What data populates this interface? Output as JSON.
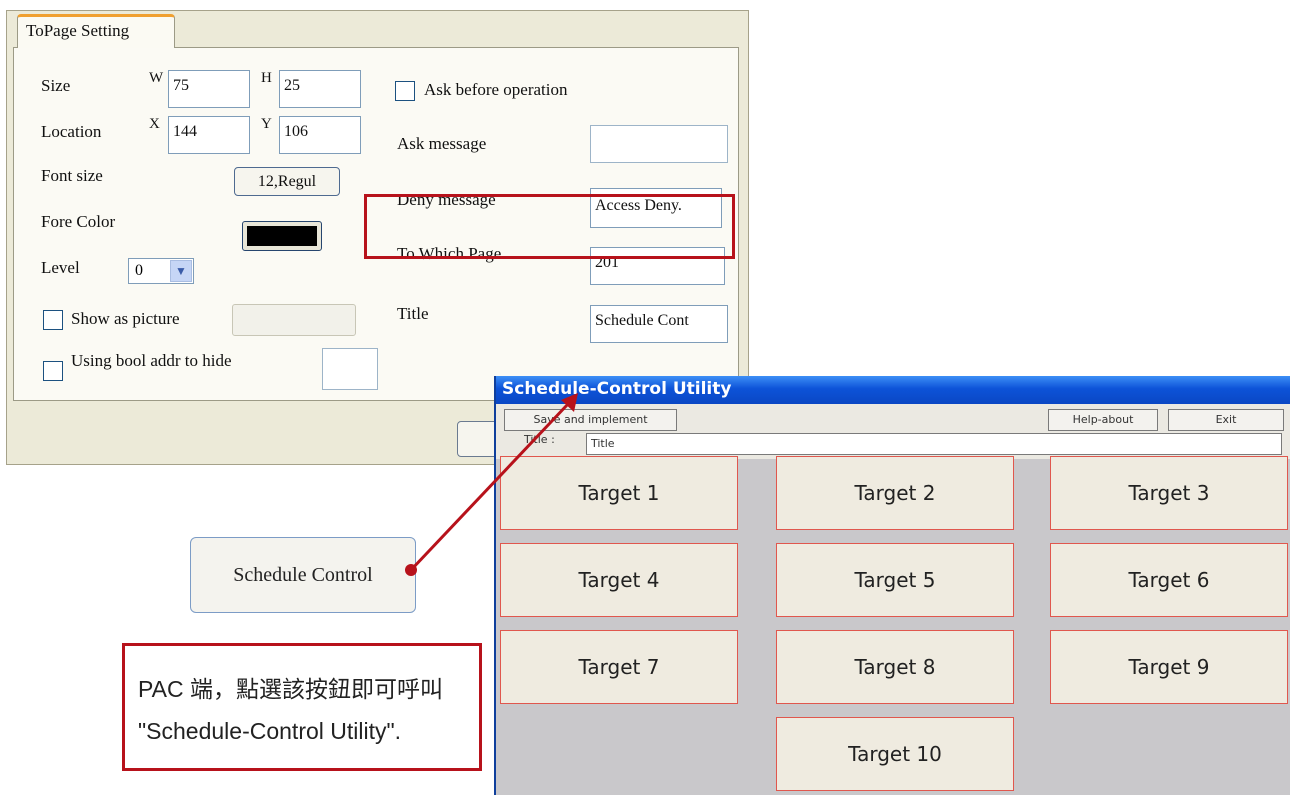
{
  "dialog": {
    "tab_label": "ToPage Setting",
    "size": {
      "label": "Size",
      "w_label": "W",
      "w_value": "75",
      "h_label": "H",
      "h_value": "25"
    },
    "location": {
      "label": "Location",
      "x_label": "X",
      "x_value": "144",
      "y_label": "Y",
      "y_value": "106"
    },
    "font_size": {
      "label": "Font size",
      "value": "12,Regul"
    },
    "fore_color": {
      "label": "Fore Color",
      "color": "#000000"
    },
    "level": {
      "label": "Level",
      "value": "0"
    },
    "show_as_picture": {
      "label": "Show as picture",
      "checked": false
    },
    "bool_hide": {
      "label": "Using bool addr to hide",
      "checked": false
    },
    "ask_before": {
      "label": "Ask before operation",
      "checked": false
    },
    "ask_message": {
      "label": "Ask message",
      "value": ""
    },
    "deny_message": {
      "label": "Deny message",
      "value": "Access Deny."
    },
    "to_which_page": {
      "label": "To Which Page",
      "value": "201"
    },
    "title": {
      "label": "Title",
      "value": "Schedule Cont"
    },
    "highlight_color": "#b7121b"
  },
  "schedule_button": {
    "label": "Schedule Control"
  },
  "note": {
    "line1": "PAC 端，點選該按鈕即可呼叫",
    "line2": "\"Schedule-Control Utility\"."
  },
  "utility": {
    "window_title": "Schedule-Control Utility",
    "save_button": "Save and implement",
    "help_button": "Help-about",
    "exit_button": "Exit",
    "title_label": "Title :",
    "title_value": "Title",
    "targets": [
      "Target 1",
      "Target 2",
      "Target 3",
      "Target 4",
      "Target 5",
      "Target 6",
      "Target 7",
      "Target 8",
      "Target 9",
      "Target 10"
    ]
  }
}
